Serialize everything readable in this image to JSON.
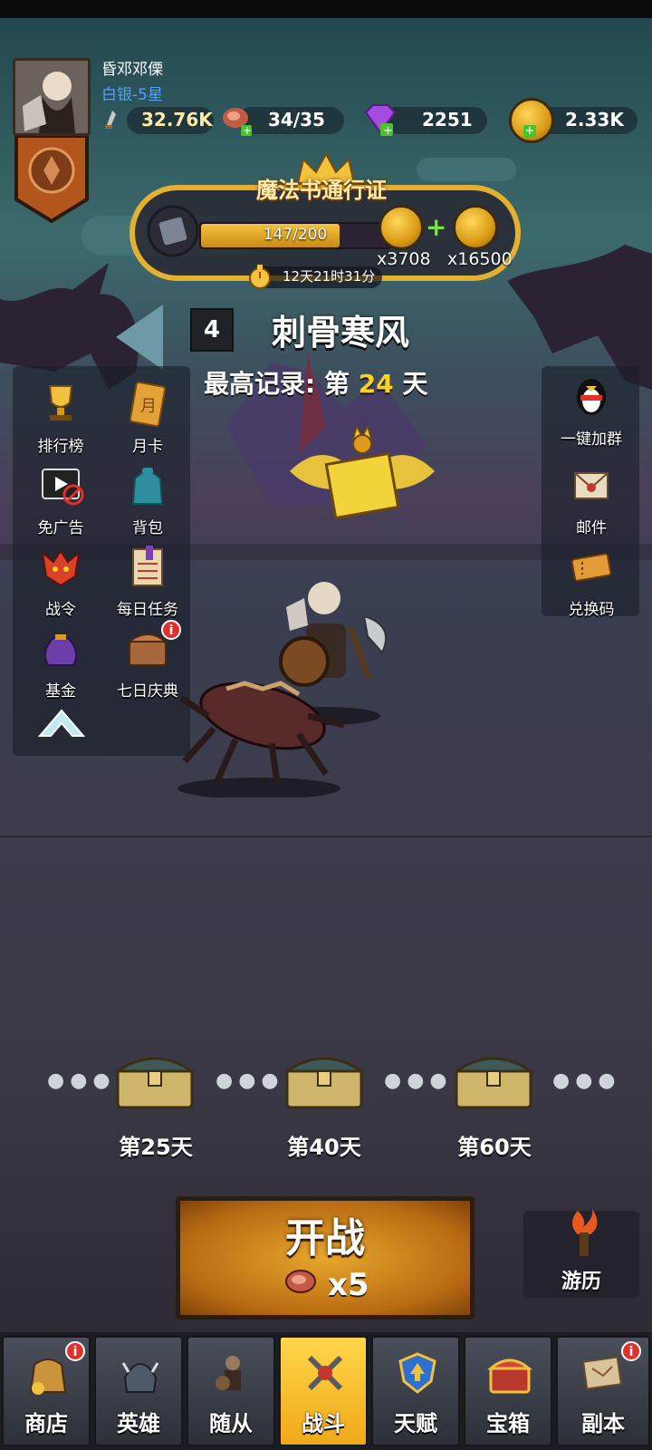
{
  "player": {
    "name": "昏邓邓傈",
    "rank": "白银-5星"
  },
  "resources": {
    "power": "32.76K",
    "stamina": "34/35",
    "gems": "2251",
    "gold": "2.33K"
  },
  "pass": {
    "title": "魔法书通行证",
    "progress": "147/200",
    "progress_fraction": 0.735,
    "reward1": "x3708",
    "reward2": "x16500",
    "timer": "12天21时31分"
  },
  "stage": {
    "number": "4",
    "name": "刺骨寒风",
    "record_prefix": "最高记录: 第",
    "record_day": "24",
    "record_suffix": "天"
  },
  "left_menu": [
    {
      "label": "排行榜",
      "icon": "trophy-icon"
    },
    {
      "label": "月卡",
      "icon": "monthly-card-icon"
    },
    {
      "label": "免广告",
      "icon": "no-ads-icon"
    },
    {
      "label": "背包",
      "icon": "backpack-icon"
    },
    {
      "label": "战令",
      "icon": "battle-pass-icon"
    },
    {
      "label": "每日任务",
      "icon": "daily-tasks-icon"
    },
    {
      "label": "基金",
      "icon": "fund-bag-icon"
    },
    {
      "label": "七日庆典",
      "icon": "seven-day-chest-icon"
    }
  ],
  "right_menu": [
    {
      "label": "一键加群",
      "icon": "qq-penguin-icon"
    },
    {
      "label": "邮件",
      "icon": "mail-icon"
    },
    {
      "label": "兑换码",
      "icon": "ticket-icon"
    }
  ],
  "badge": "i",
  "chests": [
    {
      "label": "第25天"
    },
    {
      "label": "第40天"
    },
    {
      "label": "第60天"
    }
  ],
  "start": {
    "label": "开战",
    "cost": "x5"
  },
  "travel": {
    "label": "游历"
  },
  "nav": [
    {
      "label": "商店",
      "icon": "shop-icon",
      "badge": true
    },
    {
      "label": "英雄",
      "icon": "hero-helmet-icon",
      "badge": false
    },
    {
      "label": "随从",
      "icon": "follower-icon",
      "badge": false
    },
    {
      "label": "战斗",
      "icon": "battle-swords-icon",
      "badge": false,
      "active": true
    },
    {
      "label": "天赋",
      "icon": "talent-shield-icon",
      "badge": false
    },
    {
      "label": "宝箱",
      "icon": "treasure-chest-icon",
      "badge": false
    },
    {
      "label": "副本",
      "icon": "dungeon-map-icon",
      "badge": true
    }
  ],
  "colors": {
    "gold": "#e3b12f",
    "highlight_yellow": "#ffd21f",
    "rank_blue": "#4fa3ff",
    "active_tab": "#ffd64a"
  }
}
